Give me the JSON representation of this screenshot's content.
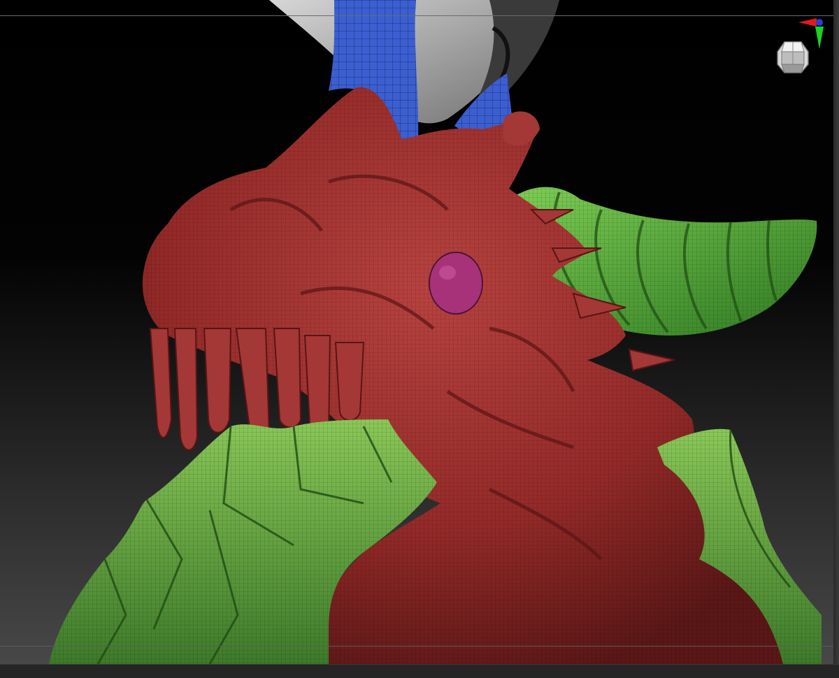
{
  "viewport": {
    "statusbar_text": "",
    "colors": {
      "dragon_skin": "#9b2e2c",
      "horn_blue": "#3b5fd0",
      "horn_green": "#47a832",
      "foliage_green": "#5aa53a",
      "eye": "#a8327a",
      "background_top": "#000000",
      "background_bottom": "#4a4a4a"
    }
  },
  "icons": {
    "gizmo": "axis-gizmo-icon",
    "navcube": "navigation-cube-icon"
  }
}
